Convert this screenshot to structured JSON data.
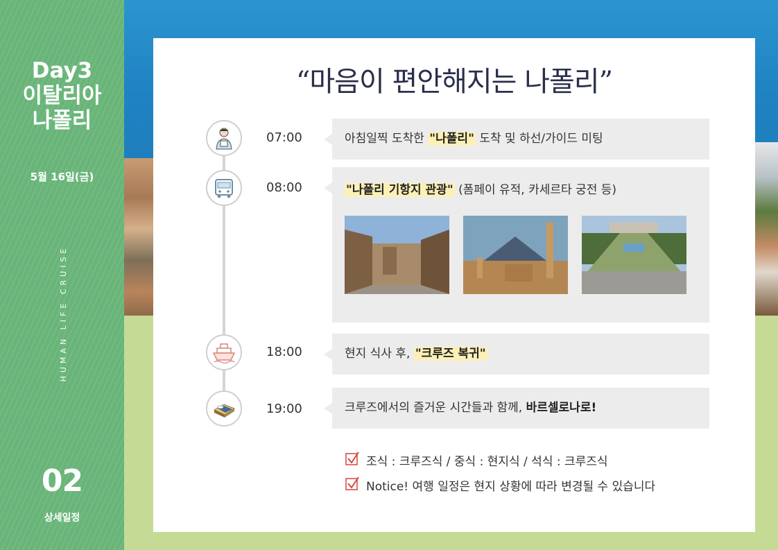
{
  "sidebar": {
    "day": "Day3",
    "country": "이탈리아",
    "city": "나폴리",
    "date": "5월 16일(금)",
    "brand_vertical": "HUMAN LIFE CRUISE",
    "section_number": "02",
    "section_label": "상세일정"
  },
  "title": "“마음이 편안해지는 나폴리”",
  "schedule": [
    {
      "time": "07:00",
      "icon": "guide-person-icon",
      "pre": "아침일찍 도착한 ",
      "highlight": "\"나폴리\"",
      "post": " 도착 및 하선/가이드 미팅"
    },
    {
      "time": "08:00",
      "icon": "bus-icon",
      "highlight": "\"나폴리 기항지 관광\"",
      "post": " (폼페이 유적, 카세르타 궁전 등)",
      "photos": [
        "pompeii-street-photo",
        "vesuvius-ruins-photo",
        "caserta-palace-photo"
      ]
    },
    {
      "time": "18:00",
      "icon": "cruise-ship-icon",
      "pre": "현지 식사 후,  ",
      "highlight": "\"크루즈 복귀\""
    },
    {
      "time": "19:00",
      "icon": "bed-icon",
      "pre": "크루즈에서의 즐거운 시간들과 함께, ",
      "bold": "바르셀로나로!"
    }
  ],
  "meals": "조식 : 크루즈식   /   중식 : 현지식    /   석식 : 크루즈식",
  "notice": "Notice!  여행 일정은 현지 상황에 따라 변경될 수 있습니다",
  "colors": {
    "sidebar": "#69b579",
    "background_green": "#c5db95",
    "sea_blue": "#1f82c2",
    "highlight": "#fdf0b7",
    "box": "#ececec",
    "check_red": "#d9433a"
  }
}
